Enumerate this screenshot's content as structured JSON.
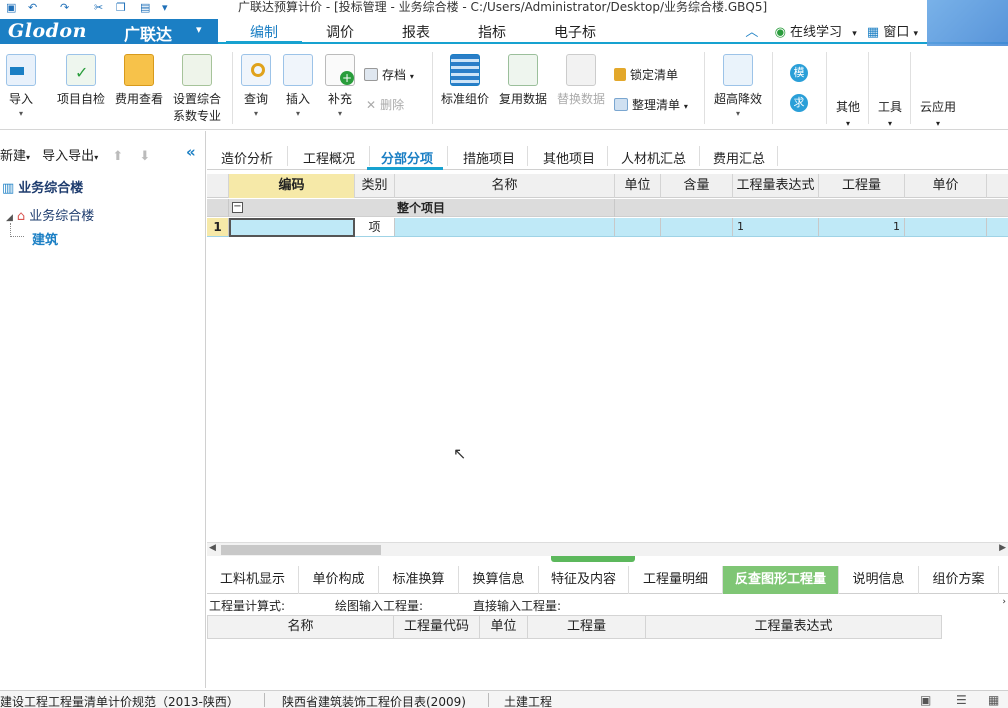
{
  "window": {
    "title": "广联达预算计价 - [投标管理 - 业务综合楼 - C:/Users/Administrator/Desktop/业务综合楼.GBQ5]"
  },
  "brand": {
    "logo": "Glodon",
    "name_cn": "广联达",
    "color": "#1b7fc4"
  },
  "menu": {
    "tabs": [
      "编制",
      "调价",
      "报表",
      "指标",
      "电子标"
    ],
    "active": "编制",
    "online_learning": "在线学习",
    "window": "窗口"
  },
  "ribbon": {
    "import": "导入",
    "self_check": "项目自检",
    "fee_view": "费用查看",
    "set_coef_1": "设置综合",
    "set_coef_2": "系数专业",
    "query": "查询",
    "insert": "插入",
    "supplement": "补充",
    "archive": "存档",
    "delete": "删除",
    "std_pricing": "标准组价",
    "reuse_data": "复用数据",
    "replace_data": "替换数据",
    "lock_list": "锁定清单",
    "organize_list": "整理清单",
    "super_high": "超高降效",
    "mo": "模",
    "qiu": "求",
    "other": "其他",
    "tools": "工具",
    "cloud": "云应用"
  },
  "left_panel": {
    "new": "新建",
    "import_export": "导入导出",
    "root": "业务综合楼",
    "child": "业务综合楼",
    "leaf": "建筑"
  },
  "content_tabs": [
    "造价分析",
    "工程概况",
    "分部分项",
    "措施项目",
    "其他项目",
    "人材机汇总",
    "费用汇总"
  ],
  "grid": {
    "headers": [
      "编码",
      "类别",
      "名称",
      "单位",
      "含量",
      "工程量表达式",
      "工程量",
      "单价"
    ],
    "group_row": "整个项目",
    "row1": {
      "index": "1",
      "code": "",
      "type": "项",
      "name": "",
      "unit": "",
      "content": "",
      "expr": "1",
      "qty": "1",
      "price": ""
    }
  },
  "bottom_tabs": [
    "工料机显示",
    "单价构成",
    "标准换算",
    "换算信息",
    "特征及内容",
    "工程量明细",
    "反查图形工程量",
    "说明信息",
    "组价方案"
  ],
  "bottom_active": "反查图形工程量",
  "formula_bar": {
    "calc": "工程量计算式:",
    "drawing": "绘图输入工程量:",
    "direct": "直接输入工程量:"
  },
  "subgrid": {
    "headers": [
      "名称",
      "工程量代码",
      "单位",
      "工程量",
      "工程量表达式"
    ]
  },
  "statusbar": {
    "spec": "建设工程工程量清单计价规范（2013-陕西）",
    "quota": "陕西省建筑装饰工程价目表(2009)",
    "category": "土建工程"
  }
}
